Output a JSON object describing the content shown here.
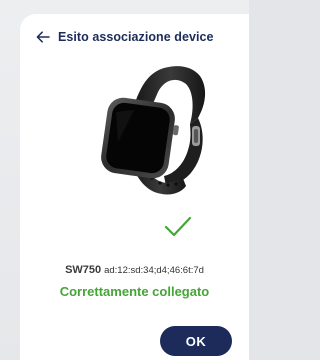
{
  "header": {
    "title": "Esito associazione device",
    "back_icon": "arrow-left-icon"
  },
  "device": {
    "image_icon": "smartwatch-image",
    "name": "SW750",
    "mac": "ad:12:sd:34;d4;46:6t:7d"
  },
  "result": {
    "icon": "checkmark-icon",
    "status": "Correttamente collegato"
  },
  "actions": {
    "ok_label": "OK"
  },
  "colors": {
    "primary": "#1c2b5a",
    "success": "#45a537",
    "background": "#e4e5e8",
    "surface": "#ffffff"
  }
}
